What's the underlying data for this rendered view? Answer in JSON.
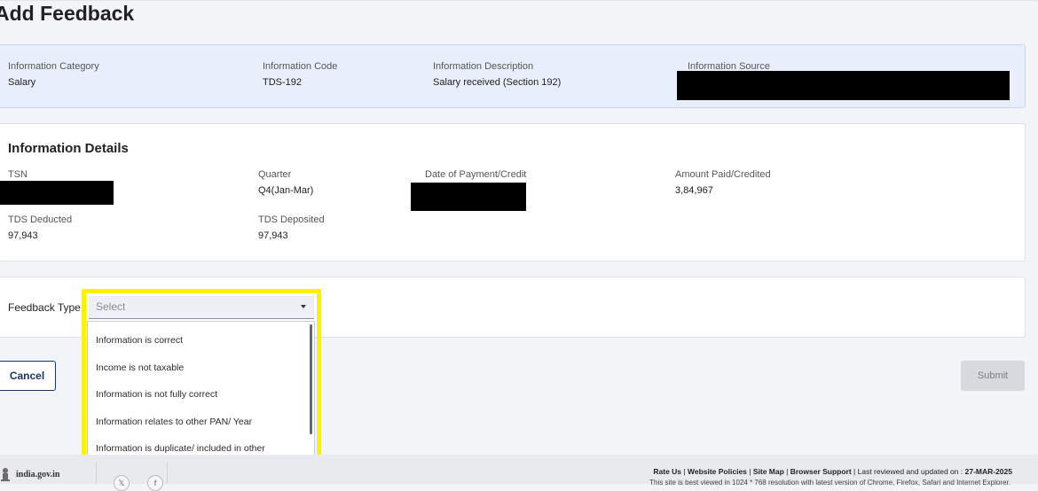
{
  "page": {
    "title": "Add Feedback"
  },
  "info_summary": {
    "category_label": "Information Category",
    "category_value": "Salary",
    "code_label": "Information Code",
    "code_value": "TDS-192",
    "description_label": "Information Description",
    "description_value": "Salary received (Section 192)",
    "source_label": "Information Source"
  },
  "details": {
    "heading": "Information Details",
    "tsn_label": "TSN",
    "quarter_label": "Quarter",
    "quarter_value": "Q4(Jan-Mar)",
    "date_label": "Date of Payment/Credit",
    "amount_label": "Amount Paid/Credited",
    "amount_value": "3,84,967",
    "tds_deducted_label": "TDS Deducted",
    "tds_deducted_value": "97,943",
    "tds_deposited_label": "TDS Deposited",
    "tds_deposited_value": "97,943"
  },
  "feedback": {
    "label": "Feedback Type:",
    "select_placeholder": "Select",
    "options": [
      "Information is correct",
      "Income is not taxable",
      "Information is not fully correct",
      "Information relates to other PAN/ Year",
      "Information is duplicate/ included in other information"
    ],
    "highlight_color": "#fff200"
  },
  "actions": {
    "cancel_label": "Cancel",
    "submit_label": "Submit"
  },
  "footer": {
    "site_name": "india.gov.in",
    "link_rate": "Rate Us",
    "link_policies": "Website Policies",
    "link_sitemap": "Site Map",
    "link_browser": "Browser Support",
    "updated_prefix": "Last reviewed and updated on : ",
    "updated_date": "27-MAR-2025",
    "note": "This site is best viewed in 1024 * 768 resolution with latest version of Chrome, Firefox, Safari and Internet Explorer."
  },
  "colors": {
    "accent": "#1b3468",
    "info_bg": "#e8effa",
    "redaction": "#000000"
  }
}
